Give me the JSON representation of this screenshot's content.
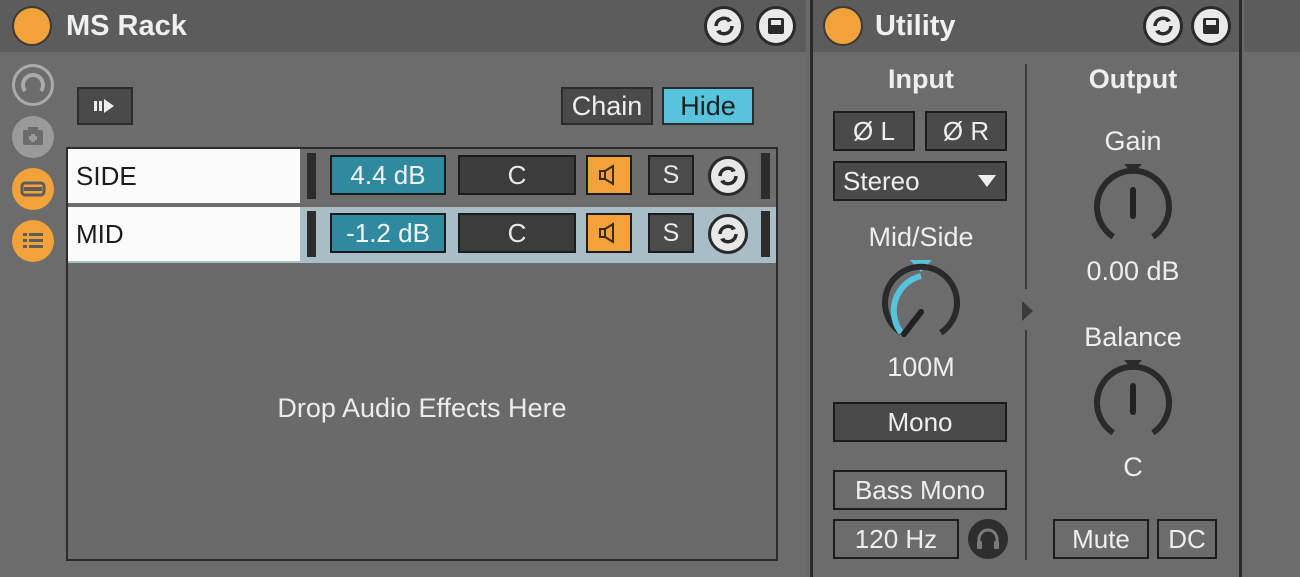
{
  "ms_rack": {
    "title": "MS Rack",
    "chain_label": "Chain",
    "hide_label": "Hide",
    "drop_text": "Drop Audio Effects Here",
    "chains": [
      {
        "name": "SIDE",
        "volume": "4.4 dB",
        "pan": "C",
        "solo": "S"
      },
      {
        "name": "MID",
        "volume": "-1.2 dB",
        "pan": "C",
        "solo": "S"
      }
    ],
    "side_icons": [
      "macro-knob-icon",
      "randomize-icon",
      "chain-list-icon",
      "device-list-icon"
    ]
  },
  "utility": {
    "title": "Utility",
    "input_label": "Input",
    "output_label": "Output",
    "phase_left": "Ø L",
    "phase_right": "Ø R",
    "channel_mode": "Stereo",
    "mid_side_label": "Mid/Side",
    "mid_side_value": "100M",
    "mono_label": "Mono",
    "bass_mono_label": "Bass Mono",
    "bass_mono_freq": "120 Hz",
    "gain_label": "Gain",
    "gain_value": "0.00 dB",
    "balance_label": "Balance",
    "balance_value": "C",
    "mute_label": "Mute",
    "dc_label": "DC"
  },
  "colors": {
    "accent_orange": "#f2a23a",
    "accent_blue": "#58c3dc",
    "panel": "#6c6c6c",
    "panel_dark": "#5c5c5c"
  }
}
